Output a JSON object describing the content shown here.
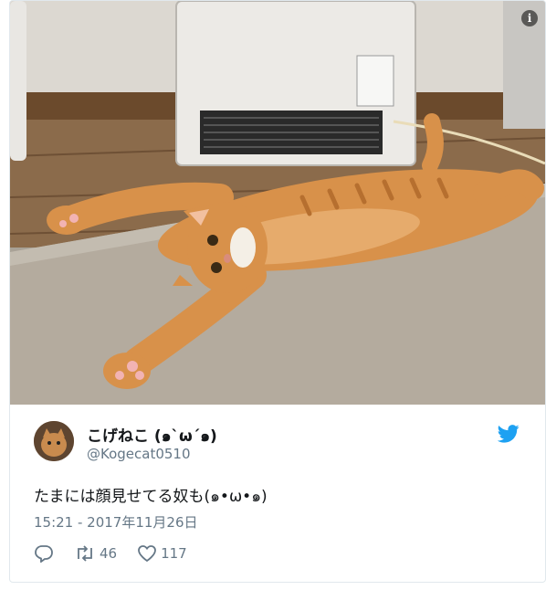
{
  "tweet": {
    "media_description_icon": "info-icon",
    "author": {
      "display_name": "こげねこ (๑`ω´๑)",
      "handle": "@Kogecat0510"
    },
    "text": "たまには顔見せてる奴も(๑•ω•๑)",
    "timestamp": "15:21 - 2017年11月26日",
    "actions": {
      "reply_icon": "reply-icon",
      "retweet_icon": "retweet-icon",
      "retweet_count": "46",
      "like_icon": "heart-icon",
      "like_count": "117"
    },
    "brand_icon": "twitter-bird-icon",
    "colors": {
      "brand": "#1da1f2",
      "text": "#14171a",
      "secondary_text": "#657786",
      "border": "#e1e8ed"
    }
  }
}
